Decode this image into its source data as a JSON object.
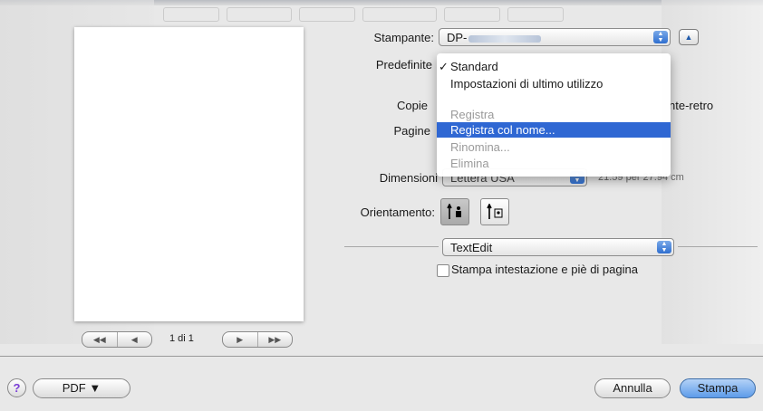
{
  "printer": {
    "label": "Stampante:",
    "name_prefix": "DP-"
  },
  "presets": {
    "label": "Predefinite",
    "menu": [
      {
        "label": "Standard",
        "checked": true,
        "enabled": true
      },
      {
        "label": "Impostazioni di ultimo utilizzo",
        "checked": false,
        "enabled": true
      },
      {
        "label": "Registra",
        "checked": false,
        "enabled": false
      },
      {
        "label": "Registra col nome...",
        "checked": false,
        "enabled": true,
        "highlighted": true
      },
      {
        "label": "Rinomina...",
        "checked": false,
        "enabled": false
      },
      {
        "label": "Elimina",
        "checked": false,
        "enabled": false
      }
    ],
    "check_mark": "✓"
  },
  "copies": {
    "label": "Copie",
    "fronte_retro_tail": "nte-retro"
  },
  "pages": {
    "label": "Pagine"
  },
  "paper_size": {
    "label": "Dimensioni",
    "value_partial": "Lettera USA",
    "dims_partial": "21.59 per 27.94 cm"
  },
  "orientation": {
    "label": "Orientamento:"
  },
  "section_popup": {
    "value": "TextEdit"
  },
  "header_footer": {
    "label": "Stampa intestazione e piè di pagina",
    "checked": false
  },
  "preview": {
    "page_indicator": "1 di 1"
  },
  "buttons": {
    "pdf": "PDF ▼",
    "cancel": "Annulla",
    "print": "Stampa",
    "help": "?"
  },
  "colors": {
    "highlight": "#2f67d3",
    "default_button": "#5d9be9",
    "help_icon": "#7a3ed6"
  }
}
